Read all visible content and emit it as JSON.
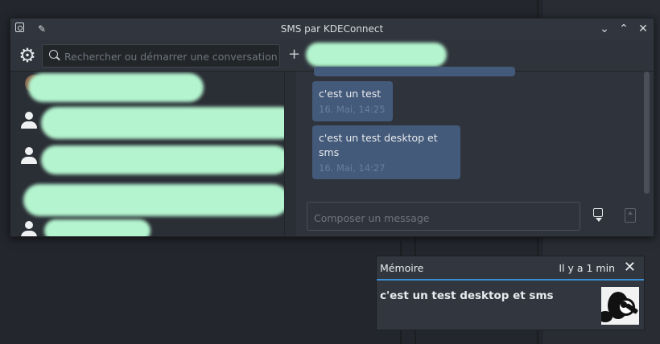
{
  "window": {
    "title": "SMS par KDEConnect",
    "controls": [
      "minimize",
      "maximize",
      "close"
    ]
  },
  "toolbar": {
    "search_placeholder": "Rechercher ou démarrer une conversation",
    "new_label": "+"
  },
  "messages": [
    {
      "text": "c'est un test",
      "time": "16. Mai, 14:25"
    },
    {
      "text": "c'est un test desktop et sms",
      "time": "16. Mai, 14:27"
    }
  ],
  "composer": {
    "placeholder": "Composer un message"
  },
  "notification": {
    "app": "Mémoire",
    "time": "Il y a 1 min",
    "body": "c'est un test desktop et sms"
  },
  "colors": {
    "accent": "#3c8fd6",
    "bubble": "#445a7a",
    "redaction": "#b4f5cf"
  }
}
